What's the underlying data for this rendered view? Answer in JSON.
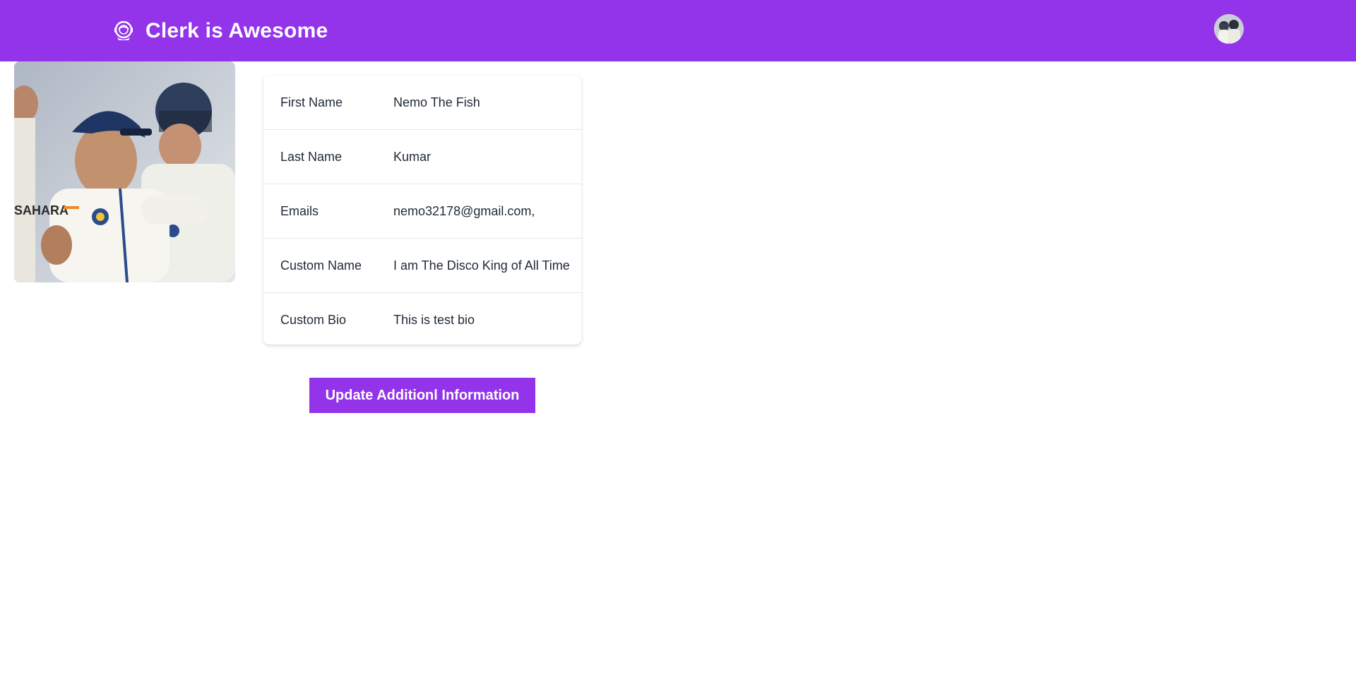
{
  "header": {
    "title": "Clerk is Awesome",
    "logo_icon": "astronaut-helmet-icon",
    "avatar_icon": "user-avatar-icon"
  },
  "profile": {
    "photo_icon": "profile-photo-icon",
    "fields": [
      {
        "label": "First Name",
        "value": "Nemo The Fish"
      },
      {
        "label": "Last Name",
        "value": "Kumar"
      },
      {
        "label": "Emails",
        "value": "nemo32178@gmail.com,"
      },
      {
        "label": "Custom Name",
        "value": "I am The Disco King of All Time"
      },
      {
        "label": "Custom Bio",
        "value": "This is test bio"
      }
    ]
  },
  "actions": {
    "update_label": "Update Additionl Information"
  },
  "colors": {
    "brand": "#9333ea",
    "text": "#1f2937",
    "divider": "#e5e7eb"
  }
}
